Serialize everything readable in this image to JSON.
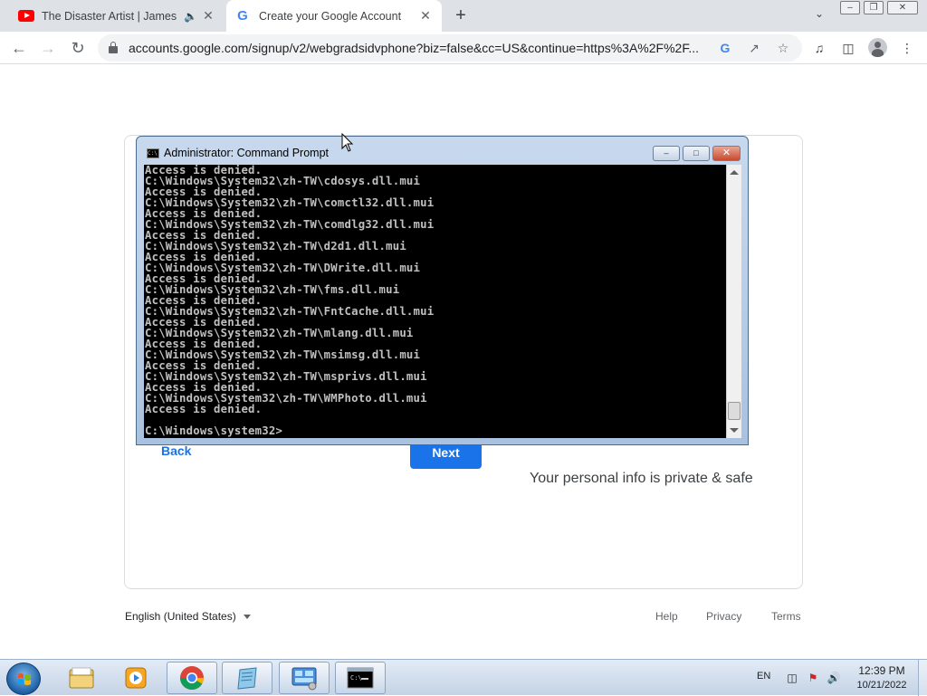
{
  "browser": {
    "tabs": [
      {
        "title": "The Disaster Artist | James Fr",
        "icon": "youtube-icon",
        "audio": true,
        "active": false
      },
      {
        "title": "Create your Google Account",
        "icon": "google-icon",
        "active": true
      }
    ],
    "new_tab_label": "+",
    "url": "accounts.google.com/signup/v2/webgradsidvphone?biz=false&cc=US&continue=https%3A%2F%2F..."
  },
  "page": {
    "back_label": "Back",
    "next_label": "Next",
    "private_note": "Your personal info is private & safe",
    "language": "English (United States)",
    "footer_links": [
      "Help",
      "Privacy",
      "Terms"
    ],
    "colors": {
      "accent": "#1a73e8"
    }
  },
  "cmd_window": {
    "title": "Administrator: Command Prompt",
    "lines": [
      "Access is denied.",
      "C:\\Windows\\System32\\zh-TW\\cdosys.dll.mui",
      "Access is denied.",
      "C:\\Windows\\System32\\zh-TW\\comctl32.dll.mui",
      "Access is denied.",
      "C:\\Windows\\System32\\zh-TW\\comdlg32.dll.mui",
      "Access is denied.",
      "C:\\Windows\\System32\\zh-TW\\d2d1.dll.mui",
      "Access is denied.",
      "C:\\Windows\\System32\\zh-TW\\DWrite.dll.mui",
      "Access is denied.",
      "C:\\Windows\\System32\\zh-TW\\fms.dll.mui",
      "Access is denied.",
      "C:\\Windows\\System32\\zh-TW\\FntCache.dll.mui",
      "Access is denied.",
      "C:\\Windows\\System32\\zh-TW\\mlang.dll.mui",
      "Access is denied.",
      "C:\\Windows\\System32\\zh-TW\\msimsg.dll.mui",
      "Access is denied.",
      "C:\\Windows\\System32\\zh-TW\\msprivs.dll.mui",
      "Access is denied.",
      "C:\\Windows\\System32\\zh-TW\\WMPhoto.dll.mui",
      "Access is denied.",
      "",
      "C:\\Windows\\system32>"
    ]
  },
  "taskbar": {
    "items": [
      {
        "name": "windows-explorer",
        "icon": "folder-icon",
        "open": false
      },
      {
        "name": "media-player",
        "icon": "media-player-icon",
        "open": false
      },
      {
        "name": "chrome",
        "icon": "chrome-icon",
        "open": true
      },
      {
        "name": "notepad",
        "icon": "notepad-icon",
        "open": true
      },
      {
        "name": "control-panel",
        "icon": "control-panel-icon",
        "open": true
      },
      {
        "name": "command-prompt",
        "icon": "cmd-icon",
        "open": true
      }
    ],
    "language": "EN",
    "time": "12:39 PM",
    "date": "10/21/2022"
  }
}
